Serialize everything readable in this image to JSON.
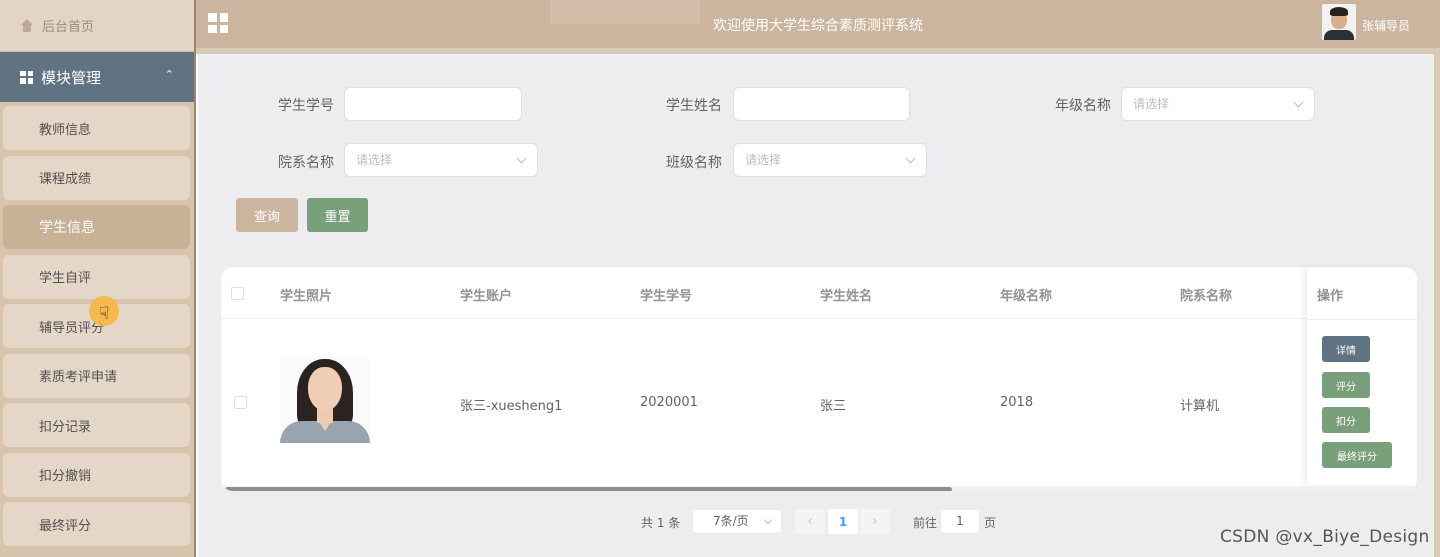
{
  "sidebar": {
    "home_label": "后台首页",
    "module_label": "模块管理",
    "items": [
      {
        "label": "教师信息"
      },
      {
        "label": "课程成绩"
      },
      {
        "label": "学生信息",
        "active": true
      },
      {
        "label": "学生自评"
      },
      {
        "label": "辅导员评分"
      },
      {
        "label": "素质考评申请"
      },
      {
        "label": "扣分记录"
      },
      {
        "label": "扣分撤销"
      },
      {
        "label": "最终评分"
      }
    ]
  },
  "header": {
    "title": "欢迎使用大学生综合素质测评系统",
    "user_name": "张辅导员"
  },
  "filters": {
    "student_no_label": "学生学号",
    "student_name_label": "学生姓名",
    "grade_label": "年级名称",
    "dept_label": "院系名称",
    "class_label": "班级名称",
    "select_placeholder": "请选择",
    "query_label": "查询",
    "reset_label": "重置"
  },
  "table": {
    "columns": [
      "学生照片",
      "学生账户",
      "学生学号",
      "学生姓名",
      "年级名称",
      "院系名称"
    ],
    "ops_header": "操作",
    "rows": [
      {
        "account": "张三-xuesheng1",
        "student_no": "2020001",
        "name": "张三",
        "grade": "2018",
        "dept": "计算机"
      }
    ],
    "op_buttons": {
      "detail": "详情",
      "score": "评分",
      "deduct": "扣分",
      "final": "最终评分"
    }
  },
  "pagination": {
    "total_text": "共 1 条",
    "page_size": "7条/页",
    "current_page": "1",
    "goto_label": "前往",
    "goto_value": "1",
    "page_suffix": "页"
  },
  "watermark": "CSDN @vx_Biye_Design",
  "colors": {
    "sidebar_bg": "#d8c4ad",
    "module_bar": "#5f7382",
    "header_bg": "#cbb59e",
    "btn_green": "#7a9f7b",
    "btn_slate": "#5f7382"
  },
  "icons": [
    "home-icon",
    "grid-icon",
    "chevron-up-icon",
    "menu-grid-icon",
    "user-avatar",
    "hand-cursor-icon",
    "chevron-down-icon",
    "chevron-left-icon",
    "chevron-right-icon"
  ]
}
